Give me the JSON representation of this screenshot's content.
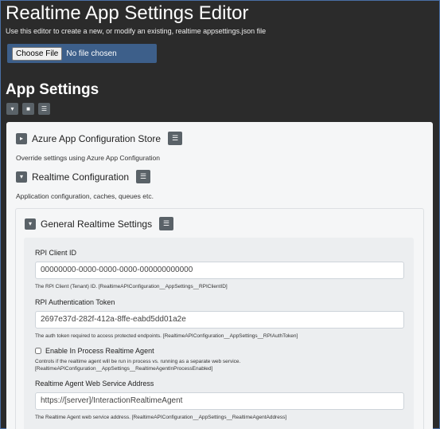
{
  "header": {
    "title": "Realtime App Settings Editor",
    "description": "Use this editor to create a new, or modify an existing, realtime appsettings.json file",
    "choose_file": "Choose File",
    "no_file": "No file chosen"
  },
  "app_settings": {
    "title": "App Settings",
    "toolbar": [
      "expand-icon",
      "save-icon",
      "list-icon"
    ]
  },
  "sections": {
    "azure": {
      "title": "Azure App Configuration Store",
      "description": "Override settings using Azure App Configuration"
    },
    "realtime": {
      "title": "Realtime Configuration",
      "description": "Application configuration, caches, queues etc."
    },
    "general": {
      "title": "General Realtime Settings",
      "fields": {
        "client_id_label": "RPI Client ID",
        "client_id_value": "00000000-0000-0000-0000-000000000000",
        "client_id_help": "The RPI Client (Tenant) ID. [RealtimeAPIConfiguration__AppSettings__RPIClientID]",
        "auth_label": "RPI Authentication Token",
        "auth_value": "2697e37d-282f-412a-8ffe-eabd5dd01a2e",
        "auth_help": "The auth token required to access protected endpoints. [RealtimeAPIConfiguration__AppSettings__RPIAuthToken]",
        "inprocess_label": "Enable In Process Realtime Agent",
        "inprocess_help": "Controls if the realtime agent will be run in process vs. running as a separate web service. [RealtimeAPIConfiguration__AppSettings__RealtimeAgentInProcessEnabled]",
        "agent_addr_label": "Realtime Agent Web Service Address",
        "agent_addr_value": "https://[server]/InteractionRealtimeAgent",
        "agent_addr_help": "The Realtime Agent web service address. [RealtimeAPIConfiguration__AppSettings__RealtimeAgentAddress]"
      }
    }
  }
}
